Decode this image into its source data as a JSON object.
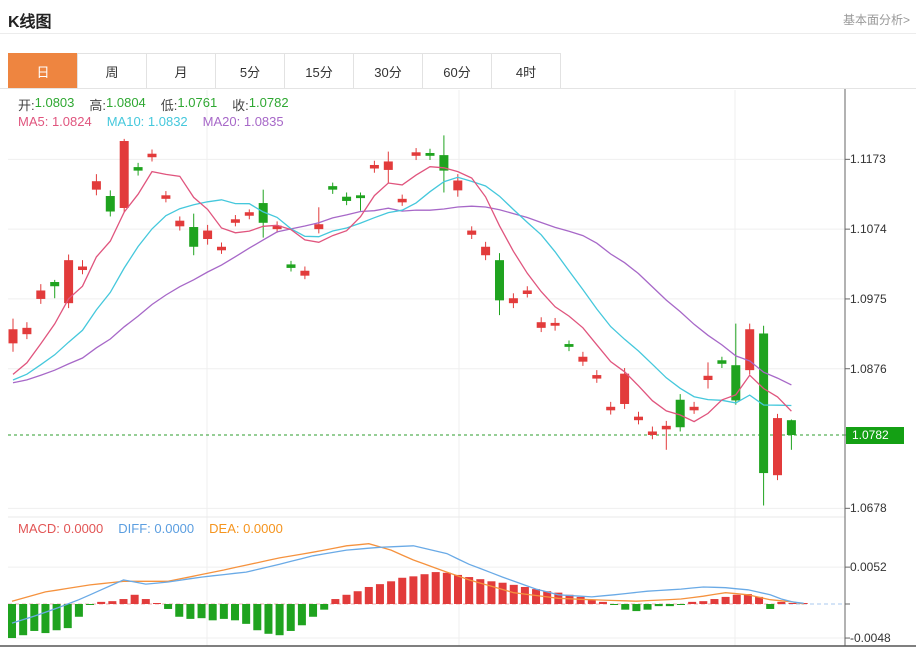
{
  "header": {
    "title": "K线图",
    "analysis_link": "基本面分析>"
  },
  "tabs": [
    {
      "label": "日",
      "active": true
    },
    {
      "label": "周",
      "active": false
    },
    {
      "label": "月",
      "active": false
    },
    {
      "label": "5分",
      "active": false
    },
    {
      "label": "15分",
      "active": false
    },
    {
      "label": "30分",
      "active": false
    },
    {
      "label": "60分",
      "active": false
    },
    {
      "label": "4时",
      "active": false
    }
  ],
  "ohlc": {
    "open_label": "开:",
    "open": "1.0803",
    "high_label": "高:",
    "high": "1.0804",
    "low_label": "低:",
    "low": "1.0761",
    "close_label": "收:",
    "close": "1.0782"
  },
  "ma_legend": [
    {
      "label": "MA5:",
      "value": "1.0824"
    },
    {
      "label": "MA10:",
      "value": "1.0832"
    },
    {
      "label": "MA20:",
      "value": "1.0835"
    }
  ],
  "macd_legend": [
    {
      "label": "MACD:",
      "value": "0.0000"
    },
    {
      "label": "DIFF:",
      "value": "0.0000"
    },
    {
      "label": "DEA:",
      "value": "0.0000"
    }
  ],
  "colors": {
    "up": "#e23b3b",
    "down": "#1fa31f",
    "ma5": "#e0557e",
    "ma10": "#45c8dc",
    "ma20": "#a768c8",
    "diff": "#6aaae6",
    "dea": "#f5923e",
    "ohlc_value": "#2fa832",
    "macd_label": "#e25555",
    "diff_label": "#5b9ee0",
    "dea_label": "#f5941e",
    "tab_active": "#ee8540",
    "price_line": "#2e9e2e",
    "badge_bg": "#14a014",
    "grid": "#efefef",
    "axis": "#666666",
    "axis_text": "#333333",
    "zero_dash": "#f0b0b0",
    "zero_dash_tail": "#a9c9ef"
  },
  "chart_data": {
    "type": "candlestick+macd",
    "title": "K线图",
    "y_axis_labels": [
      1.1173,
      1.1074,
      1.0975,
      1.0876,
      1.0678
    ],
    "current_price": 1.0782,
    "current_price_str": "1.0782",
    "macd_axis_labels": [
      0.0052,
      -0.0048
    ],
    "legend_values": {
      "ma5": 1.0824,
      "ma10": 1.0832,
      "ma20": 1.0835,
      "macd": 0.0,
      "diff": 0.0,
      "dea": 0.0
    },
    "candles": [
      [
        1.0912,
        1.0947,
        1.09,
        1.0932
      ],
      [
        1.0925,
        1.0942,
        1.0918,
        1.0934
      ],
      [
        1.0975,
        1.0996,
        1.0968,
        1.0987
      ],
      [
        1.0999,
        1.1002,
        1.0976,
        1.0993
      ],
      [
        1.0969,
        1.1038,
        1.0962,
        1.103
      ],
      [
        1.1016,
        1.103,
        1.101,
        1.1021
      ],
      [
        1.113,
        1.1152,
        1.1122,
        1.1142
      ],
      [
        1.1121,
        1.1129,
        1.1092,
        1.1099
      ],
      [
        1.1104,
        1.1202,
        1.1098,
        1.1199
      ],
      [
        1.1162,
        1.1168,
        1.115,
        1.1157
      ],
      [
        1.1176,
        1.1187,
        1.117,
        1.1181
      ],
      [
        1.1117,
        1.1128,
        1.1112,
        1.1122
      ],
      [
        1.1078,
        1.1092,
        1.1072,
        1.1086
      ],
      [
        1.1077,
        1.1096,
        1.1037,
        1.1049
      ],
      [
        1.106,
        1.108,
        1.1052,
        1.1072
      ],
      [
        1.1044,
        1.1055,
        1.1039,
        1.1049
      ],
      [
        1.1083,
        1.1094,
        1.1078,
        1.1088
      ],
      [
        1.1093,
        1.1102,
        1.1088,
        1.1098
      ],
      [
        1.1111,
        1.113,
        1.1062,
        1.1083
      ],
      [
        1.1074,
        1.1085,
        1.1069,
        1.1079
      ],
      [
        1.1024,
        1.1029,
        1.1014,
        1.1019
      ],
      [
        1.1008,
        1.1021,
        1.1003,
        1.1015
      ],
      [
        1.1074,
        1.1105,
        1.1068,
        1.1081
      ],
      [
        1.1135,
        1.114,
        1.1124,
        1.113
      ],
      [
        1.112,
        1.1126,
        1.1108,
        1.1114
      ],
      [
        1.1122,
        1.1126,
        1.11,
        1.1118
      ],
      [
        1.116,
        1.1171,
        1.1154,
        1.1165
      ],
      [
        1.1158,
        1.1184,
        1.1139,
        1.117
      ],
      [
        1.1112,
        1.1123,
        1.1107,
        1.1117
      ],
      [
        1.1178,
        1.1189,
        1.1172,
        1.1183
      ],
      [
        1.1182,
        1.1188,
        1.1172,
        1.1178
      ],
      [
        1.1179,
        1.1207,
        1.1126,
        1.1157
      ],
      [
        1.1129,
        1.1152,
        1.112,
        1.1143
      ],
      [
        1.1066,
        1.1078,
        1.106,
        1.1072
      ],
      [
        1.1037,
        1.1056,
        1.103,
        1.1049
      ],
      [
        1.103,
        1.104,
        1.0952,
        1.0973
      ],
      [
        1.0969,
        1.0983,
        1.0962,
        1.0976
      ],
      [
        1.0982,
        1.0993,
        1.0977,
        1.0987
      ],
      [
        1.0934,
        1.0949,
        1.0928,
        1.0942
      ],
      [
        1.0937,
        1.0948,
        1.093,
        1.0941
      ],
      [
        1.0911,
        1.0916,
        1.0901,
        1.0907
      ],
      [
        1.0886,
        1.09,
        1.088,
        1.0893
      ],
      [
        1.0862,
        1.0874,
        1.0856,
        1.0867
      ],
      [
        1.0817,
        1.0829,
        1.0811,
        1.0822
      ],
      [
        1.0826,
        1.0877,
        1.0819,
        1.0869
      ],
      [
        1.0803,
        1.0815,
        1.0797,
        1.0808
      ],
      [
        1.0782,
        1.0794,
        1.0776,
        1.0787
      ],
      [
        1.079,
        1.0802,
        1.0761,
        1.0795
      ],
      [
        1.0832,
        1.084,
        1.0787,
        1.0793
      ],
      [
        1.0817,
        1.0829,
        1.0812,
        1.0822
      ],
      [
        1.086,
        1.0885,
        1.0848,
        1.0866
      ],
      [
        1.0888,
        1.0893,
        1.0877,
        1.0883
      ],
      [
        1.0881,
        1.094,
        1.0825,
        1.0831
      ],
      [
        1.0874,
        1.094,
        1.0868,
        1.0932
      ],
      [
        1.0926,
        1.0937,
        1.0682,
        1.0728
      ],
      [
        1.0725,
        1.0812,
        1.0718,
        1.0806
      ],
      [
        1.0803,
        1.0804,
        1.0761,
        1.0782
      ]
    ],
    "ma_periods": [
      5,
      10,
      20
    ],
    "macd_hist": [
      -0.0048,
      -0.0044,
      -0.0038,
      -0.0041,
      -0.0037,
      -0.0034,
      -0.0018,
      -0.0001,
      0.0003,
      0.0004,
      0.0007,
      0.0013,
      0.0007,
      0.0001,
      -0.0007,
      -0.0018,
      -0.0021,
      -0.002,
      -0.0023,
      -0.0021,
      -0.0023,
      -0.0028,
      -0.0037,
      -0.0042,
      -0.0044,
      -0.0038,
      -0.003,
      -0.0018,
      -0.0008,
      0.0007,
      0.0013,
      0.0018,
      0.0024,
      0.0028,
      0.0032,
      0.0037,
      0.0039,
      0.0042,
      0.0045,
      0.0044,
      0.0041,
      0.0038,
      0.0035,
      0.0032,
      0.003,
      0.0027,
      0.0024,
      0.0021,
      0.0018,
      0.0016,
      0.0013,
      0.001,
      0.0006,
      0.0003,
      -0.0001,
      -0.0008,
      -0.001,
      -0.0008,
      -0.0003,
      -0.0003,
      -0.0001,
      0.0003,
      0.0004,
      0.0007,
      0.001,
      0.0013,
      0.0014,
      0.001,
      -0.0007,
      0.0003,
      0.0001,
      0.0
    ],
    "diff_anchors": [
      [
        0,
        -0.0027
      ],
      [
        2,
        -0.0017
      ],
      [
        4,
        -0.0006
      ],
      [
        6,
        0.0006
      ],
      [
        8,
        0.002
      ],
      [
        10,
        0.0034
      ],
      [
        12,
        0.0028
      ],
      [
        14,
        0.0031
      ],
      [
        17,
        0.0038
      ],
      [
        21,
        0.0045
      ],
      [
        24,
        0.0056
      ],
      [
        27,
        0.0068
      ],
      [
        30,
        0.0076
      ],
      [
        33,
        0.008
      ],
      [
        36,
        0.0082
      ],
      [
        39,
        0.0071
      ],
      [
        41,
        0.0056
      ],
      [
        44,
        0.0038
      ],
      [
        47,
        0.0021
      ],
      [
        49,
        0.0013
      ],
      [
        52,
        0.001
      ],
      [
        54,
        0.0013
      ],
      [
        57,
        0.0018
      ],
      [
        60,
        0.0021
      ],
      [
        62,
        0.0024
      ],
      [
        64,
        0.0023
      ],
      [
        66,
        0.002
      ],
      [
        68,
        0.0013
      ],
      [
        69,
        0.0007
      ],
      [
        70,
        0.0003
      ],
      [
        71,
        0.0001
      ]
    ],
    "dea_anchors": [
      [
        0,
        0.0004
      ],
      [
        3,
        0.0017
      ],
      [
        7,
        0.0027
      ],
      [
        10,
        0.0032
      ],
      [
        14,
        0.0032
      ],
      [
        19,
        0.0048
      ],
      [
        24,
        0.0065
      ],
      [
        27,
        0.0073
      ],
      [
        30,
        0.0082
      ],
      [
        32,
        0.0085
      ],
      [
        34,
        0.0076
      ],
      [
        36,
        0.0062
      ],
      [
        39,
        0.0045
      ],
      [
        41,
        0.0034
      ],
      [
        45,
        0.0016
      ],
      [
        49,
        0.0008
      ],
      [
        52,
        0.0006
      ],
      [
        56,
        0.0004
      ],
      [
        60,
        0.0007
      ],
      [
        62,
        0.0011
      ],
      [
        64,
        0.0016
      ],
      [
        66,
        0.0013
      ],
      [
        68,
        0.0006
      ],
      [
        70,
        0.0003
      ],
      [
        71,
        0.0
      ]
    ]
  }
}
